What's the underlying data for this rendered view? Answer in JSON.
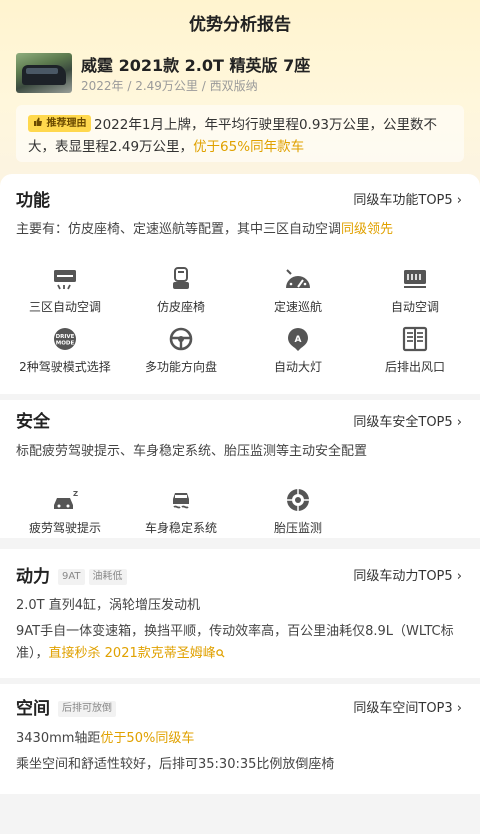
{
  "header": {
    "title": "优势分析报告"
  },
  "car": {
    "name": "威霆 2021款 2.0T 精英版 7座",
    "meta": "2022年 / 2.49万公里 / 西双版纳"
  },
  "recommend": {
    "badge": "推荐理由",
    "text": "2022年1月上牌，年平均行驶里程0.93万公里，公里数不大，表显里程2.49万公里，",
    "highlight": "优于65%同年款车"
  },
  "function": {
    "title": "功能",
    "rank_link": "同级车功能TOP5 ›",
    "desc": "主要有：仿皮座椅、定速巡航等配置，其中三区自动空调",
    "desc_hl": "同级领先",
    "features": [
      {
        "label": "三区自动空调",
        "icon": "ac-zone-icon"
      },
      {
        "label": "仿皮座椅",
        "icon": "seat-icon"
      },
      {
        "label": "定速巡航",
        "icon": "cruise-icon"
      },
      {
        "label": "自动空调",
        "icon": "auto-ac-icon"
      },
      {
        "label": "2种驾驶模式选择",
        "icon": "drive-mode-icon"
      },
      {
        "label": "多功能方向盘",
        "icon": "steering-wheel-icon"
      },
      {
        "label": "自动大灯",
        "icon": "auto-headlight-icon"
      },
      {
        "label": "后排出风口",
        "icon": "rear-vent-icon"
      }
    ],
    "drive_badge": "DRIVE MODE",
    "light_badge": "A"
  },
  "safety": {
    "title": "安全",
    "rank_link": "同级车安全TOP5 ›",
    "desc": "标配疲劳驾驶提示、车身稳定系统、胎压监测等主动安全配置",
    "features": [
      {
        "label": "疲劳驾驶提示",
        "icon": "fatigue-icon"
      },
      {
        "label": "车身稳定系统",
        "icon": "stability-icon"
      },
      {
        "label": "胎压监测",
        "icon": "tire-pressure-icon"
      }
    ]
  },
  "power": {
    "title": "动力",
    "tags": [
      "9AT",
      "油耗低"
    ],
    "rank_link": "同级车动力TOP5 ›",
    "line1": "2.0T 直列4缸，涡轮增压发动机",
    "line2": "9AT手自一体变速箱，换挡平顺，传动效率高，百公里油耗仅8.9L（WLTC标准），",
    "line2_hl": "直接秒杀 2021款克蒂圣姆峰"
  },
  "space": {
    "title": "空间",
    "tag": "后排可放倒",
    "rank_link": "同级车空间TOP3 ›",
    "line1": "3430mm轴距",
    "line1_hl": "优于50%同级车",
    "line2": "乘坐空间和舒适性较好，后排可35:30:35比例放倒座椅"
  },
  "colors": {
    "accent": "#e0a100",
    "badge": "#ffd84d",
    "icon": "#555555"
  }
}
